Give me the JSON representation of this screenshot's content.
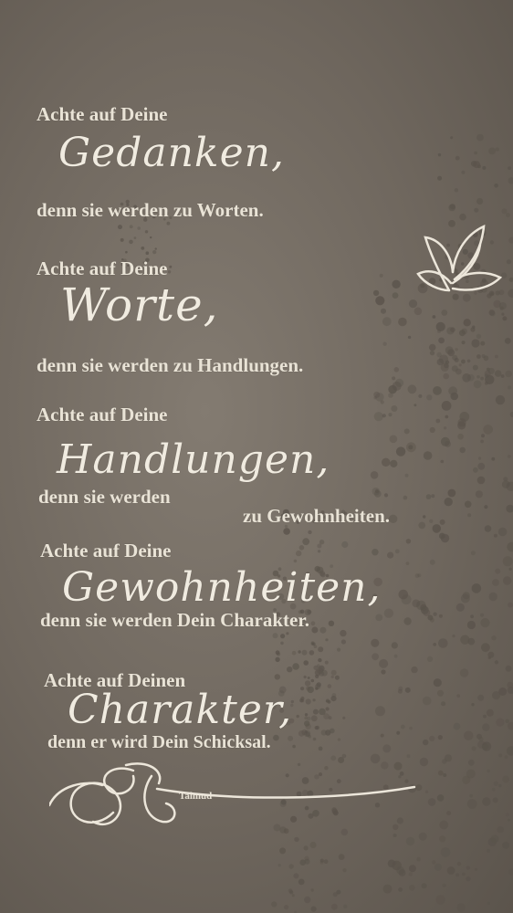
{
  "quote": {
    "stanzas": [
      {
        "intro": "Achte auf Deine",
        "word": "Gedanken,",
        "result": "denn sie werden zu Worten."
      },
      {
        "intro": "Achte auf Deine",
        "word": "Worte,",
        "result": "denn sie werden zu Handlungen."
      },
      {
        "intro": "Achte auf Deine",
        "word": "Handlungen,",
        "result_a": "denn sie werden",
        "result_b": "zu Gewohnheiten."
      },
      {
        "intro": "Achte auf Deine",
        "word": "Gewohnheiten,",
        "result": "denn sie werden Dein Charakter."
      },
      {
        "intro": "Achte auf Deinen",
        "word": "Charakter,",
        "result": "denn er wird Dein Schicksal."
      }
    ],
    "source": "Talmud"
  },
  "colors": {
    "wall": "#766e65",
    "lettering": "#e9e3d6",
    "dots": "#5a534b"
  },
  "icons": [
    "butterfly-icon",
    "swirl-flourish-icon"
  ]
}
